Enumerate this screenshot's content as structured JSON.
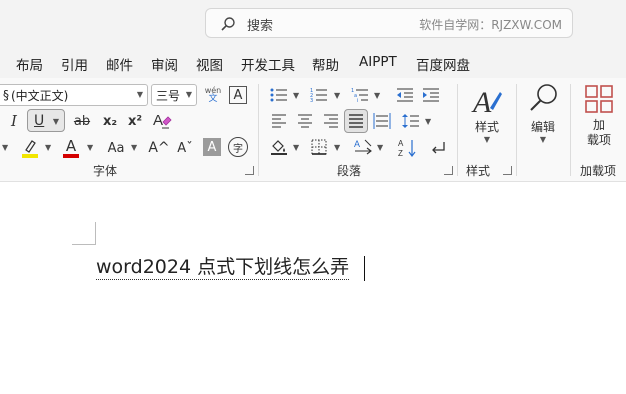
{
  "search": {
    "label": "搜索",
    "watermark": "软件自学网：RJZXW.COM"
  },
  "tabs": [
    "布局",
    "引用",
    "邮件",
    "审阅",
    "视图",
    "开发工具",
    "帮助",
    "AIPPT",
    "百度网盘"
  ],
  "font": {
    "name_value": "(中文正文)",
    "size_value": "三号",
    "phonetic_top": "wén",
    "phonetic_bottom": "文",
    "border_char": "A",
    "italic": "I",
    "underline": "U",
    "strike": "ab",
    "subscript": "x₂",
    "superscript": "x²",
    "highlight_char": "ꜗ",
    "font_color_char": "A",
    "change_case": "Aa",
    "grow": "A^",
    "shrink": "Aˇ",
    "shading_char": "A",
    "circle_char": "字",
    "group_label": "字体"
  },
  "paragraph": {
    "group_label": "段落"
  },
  "styles": {
    "label": "样式",
    "group_label": "样式"
  },
  "editing": {
    "label": "编辑"
  },
  "addins": {
    "label_line1": "加",
    "label_line2": "载项",
    "group_label": "加载项"
  },
  "colors": {
    "highlight": "#f2e600",
    "font_color": "#d40000",
    "accent": "#c0504d"
  },
  "document": {
    "text": "word2024 点式下划线怎么弄"
  }
}
